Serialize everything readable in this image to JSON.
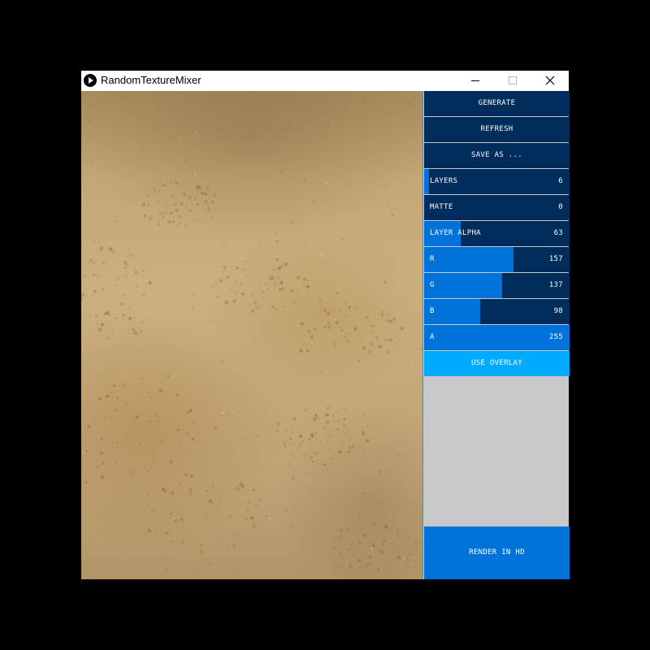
{
  "window": {
    "title": "RandomTextureMixer",
    "controls": {
      "minimize_icon": "minimize-icon",
      "maximize_icon": "maximize-icon",
      "close_icon": "close-icon"
    }
  },
  "canvas": {
    "description_icon": "texture-preview"
  },
  "panel": {
    "buttons": {
      "generate": "GENERATE",
      "refresh": "REFRESH",
      "save_as": "SAVE AS ..."
    },
    "sliders": [
      {
        "label": "LAYERS",
        "value": 6,
        "fraction": 0.033
      },
      {
        "label": "MATTE",
        "value": 0,
        "fraction": 0.0
      },
      {
        "label": "LAYER ALPHA",
        "value": 63,
        "fraction": 0.25
      },
      {
        "label": "R",
        "value": 157,
        "fraction": 0.616
      },
      {
        "label": "G",
        "value": 137,
        "fraction": 0.537
      },
      {
        "label": "B",
        "value": 98,
        "fraction": 0.384
      },
      {
        "label": "A",
        "value": 255,
        "fraction": 1.0
      }
    ],
    "toggle": {
      "label": "USE OVERLAY",
      "on": true
    },
    "render": {
      "label": "RENDER IN HD"
    }
  },
  "colors": {
    "control_bg": "#002d5c",
    "slider_fill": "#0073db",
    "toggle_on": "#00aaff",
    "panel_empty": "#c8c8c8"
  }
}
